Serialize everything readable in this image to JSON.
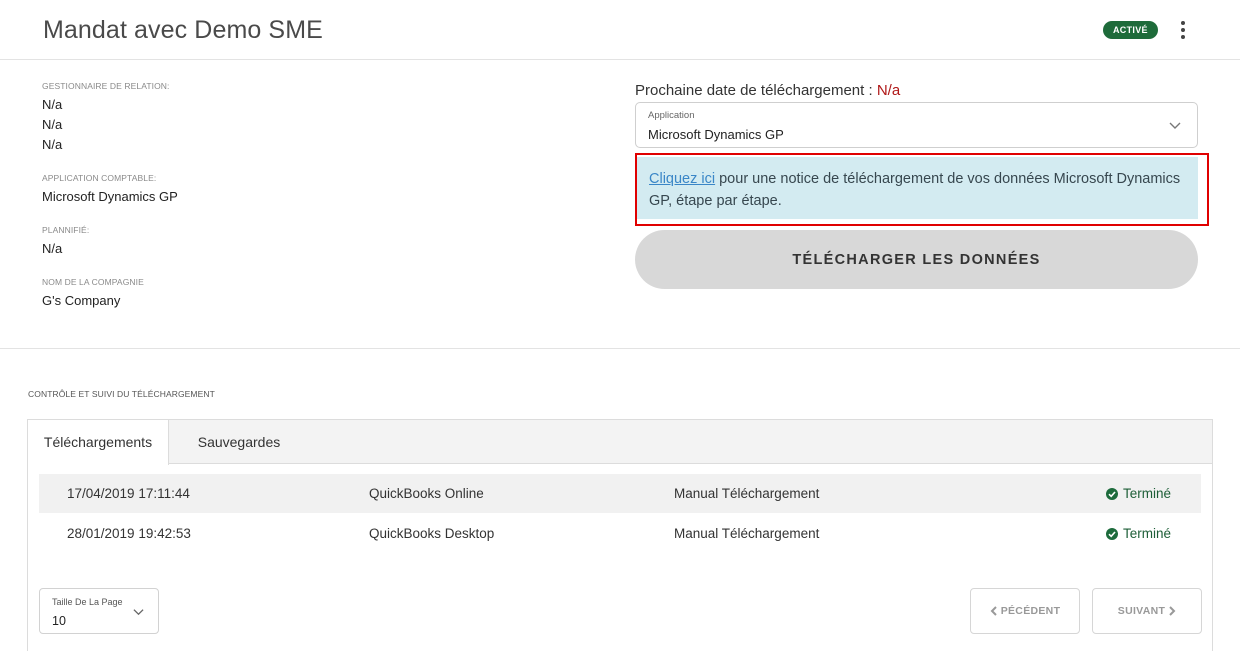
{
  "header": {
    "title": "Mandat avec Demo SME",
    "status_badge": "ACTIVÉ",
    "menu_icon": "more-vertical-icon"
  },
  "info": {
    "relationship_manager_label": "GESTIONNAIRE DE RELATION:",
    "relationship_manager_values": [
      "N/a",
      "N/a",
      "N/a"
    ],
    "accounting_app_label": "APPLICATION COMPTABLE:",
    "accounting_app_value": "Microsoft Dynamics GP",
    "planned_label": "PLANNIFIÉ:",
    "planned_value": "N/a",
    "company_label": "NOM DE LA COMPAGNIE",
    "company_value": "G's Company"
  },
  "download": {
    "next_date_label": "Prochaine date de téléchargement :",
    "next_date_value": "N/a",
    "application_label": "Application",
    "application_value": "Microsoft Dynamics GP",
    "notice_link": "Cliquez ici",
    "notice_text": " pour une notice de téléchargement de vos données Microsoft Dynamics GP, étape par étape.",
    "button_label": "TÉLÉCHARGER LES DONNÉES"
  },
  "tracking": {
    "section_title": "CONTRÔLE ET SUIVI DU TÉLÉCHARGEMENT",
    "tabs": [
      {
        "label": "Téléchargements",
        "active": true
      },
      {
        "label": "Sauvegardes",
        "active": false
      }
    ],
    "rows": [
      {
        "date": "17/04/2019 17:11:44",
        "app": "QuickBooks Online",
        "type": "Manual Téléchargement",
        "status": "Terminé"
      },
      {
        "date": "28/01/2019 19:42:53",
        "app": "QuickBooks Desktop",
        "type": "Manual Téléchargement",
        "status": "Terminé"
      }
    ],
    "page_size_label": "Taille De La Page",
    "page_size_value": "10",
    "prev_label": "PÉCÉDENT",
    "next_label": "SUIVANT"
  },
  "colors": {
    "badge": "#1e6b3a",
    "na_red": "#b01818",
    "notice_bg": "#d3ebf1",
    "highlight_outline": "#e00000",
    "link": "#3a86c7",
    "status_green": "#1d5e37"
  }
}
